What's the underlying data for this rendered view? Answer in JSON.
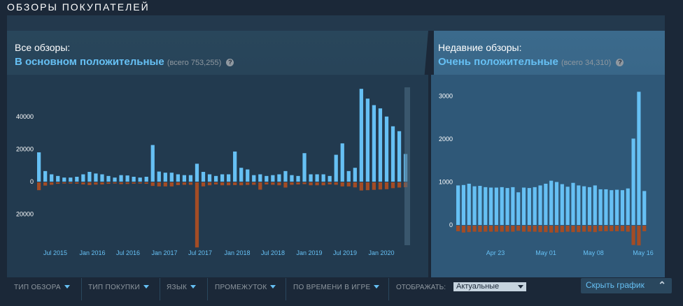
{
  "section_title": "ОБЗОРЫ ПОКУПАТЕЛЕЙ",
  "all_reviews": {
    "label": "Все обзоры:",
    "summary": "В основном положительные",
    "total": "(всего 753,255)",
    "help_icon": "question-icon"
  },
  "recent_reviews": {
    "label": "Недавние обзоры:",
    "summary": "Очень положительные",
    "total": "(всего 34,310)",
    "help_icon": "question-icon"
  },
  "filters": [
    {
      "label": "ТИП ОБЗОРА"
    },
    {
      "label": "ТИП ПОКУПКИ"
    },
    {
      "label": "ЯЗЫК"
    },
    {
      "label": "ПРОМЕЖУТОК"
    },
    {
      "label": "ПО ВРЕМЕНИ В ИГРЕ"
    }
  ],
  "display": {
    "label": "ОТОБРАЖАТЬ:",
    "selected": "Актуальные"
  },
  "hide_graph": {
    "label": "Скрыть график",
    "icon": "double-chevron-up-icon"
  },
  "colors": {
    "positive": "#66c0f4",
    "negative": "#a34c25",
    "accent": "#66c0f4"
  },
  "chart_data": [
    {
      "type": "bar",
      "y_ticks": [
        "40000",
        "20000",
        "0",
        "20000"
      ],
      "ylim": [
        -40000,
        55000
      ],
      "x_tick_labels": [
        "Jul 2015",
        "Jan 2016",
        "Jul 2016",
        "Jan 2017",
        "Jul 2017",
        "Jan 2018",
        "Jul 2018",
        "Jan 2019",
        "Jul 2019",
        "Jan 2020"
      ],
      "series": [
        {
          "values": [
            18000,
            6500,
            4500,
            3500,
            2500,
            2500,
            3000,
            4500,
            6000,
            5000,
            4500,
            3500,
            2500,
            4000,
            3800,
            3000,
            2500,
            3000,
            22500,
            6200,
            5500,
            5500,
            4500,
            4000,
            4000,
            11000,
            6000,
            4500,
            3500,
            4500,
            4500,
            18500,
            8500,
            7500,
            4000,
            4500,
            3500,
            4000,
            4500,
            6500,
            4000,
            3500,
            17500,
            4500,
            4500,
            4500,
            3500,
            16500,
            23500,
            6500,
            8500,
            57000,
            51000,
            47000,
            45000,
            40000,
            34000,
            31000,
            17000
          ]
        },
        {
          "values": [
            -4800,
            -2000,
            -1500,
            -900,
            -700,
            -700,
            -800,
            -1300,
            -1700,
            -1400,
            -1300,
            -900,
            -700,
            -1100,
            -1000,
            -800,
            -700,
            -900,
            -2200,
            -2500,
            -2500,
            -2500,
            -1700,
            -1500,
            -1500,
            -40000,
            -2500,
            -1800,
            -1300,
            -1800,
            -1800,
            -1700,
            -1800,
            -1600,
            -1500,
            -4500,
            -1300,
            -1500,
            -1800,
            -3200,
            -1500,
            -1300,
            -1100,
            -1800,
            -1800,
            -1800,
            -1300,
            -1500,
            -2500,
            -2500,
            -3100,
            -5000,
            -4800,
            -4600,
            -4400,
            -4200,
            -3600,
            -3200,
            -3000
          ]
        }
      ]
    },
    {
      "type": "bar",
      "y_ticks": [
        "3000",
        "2000",
        "1000",
        "0"
      ],
      "ylim": [
        -450,
        3200
      ],
      "x_tick_labels": [
        "Apr 23",
        "May 01",
        "May 08",
        "May 16"
      ],
      "series": [
        {
          "values": [
            920,
            930,
            960,
            900,
            910,
            880,
            870,
            870,
            880,
            860,
            880,
            760,
            870,
            860,
            880,
            920,
            960,
            1030,
            1000,
            950,
            890,
            980,
            920,
            900,
            880,
            920,
            830,
            830,
            810,
            820,
            810,
            850,
            2010,
            3100,
            790
          ]
        },
        {
          "values": [
            -130,
            -160,
            -150,
            -140,
            -145,
            -140,
            -140,
            -140,
            -140,
            -140,
            -140,
            -120,
            -140,
            -140,
            -140,
            -150,
            -150,
            -160,
            -160,
            -150,
            -140,
            -150,
            -150,
            -140,
            -140,
            -150,
            -130,
            -130,
            -130,
            -130,
            -130,
            -140,
            -450,
            -460,
            -130
          ]
        }
      ]
    }
  ]
}
